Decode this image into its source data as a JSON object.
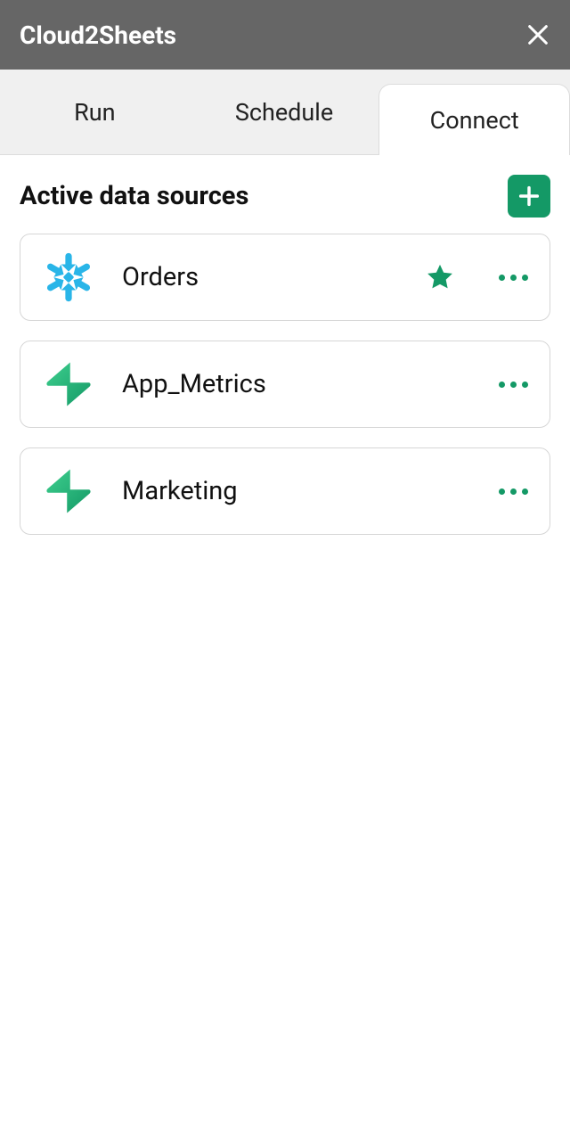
{
  "header": {
    "title": "Cloud2Sheets"
  },
  "tabs": {
    "items": [
      {
        "label": "Run"
      },
      {
        "label": "Schedule"
      },
      {
        "label": "Connect"
      }
    ],
    "activeIndex": 2
  },
  "section": {
    "title": "Active data sources"
  },
  "sources": [
    {
      "name": "Orders",
      "iconType": "snowflake",
      "starred": true
    },
    {
      "name": "App_Metrics",
      "iconType": "supabase",
      "starred": false
    },
    {
      "name": "Marketing",
      "iconType": "supabase",
      "starred": false
    }
  ],
  "colors": {
    "accent": "#149966",
    "snowflake": "#29B5E8"
  }
}
